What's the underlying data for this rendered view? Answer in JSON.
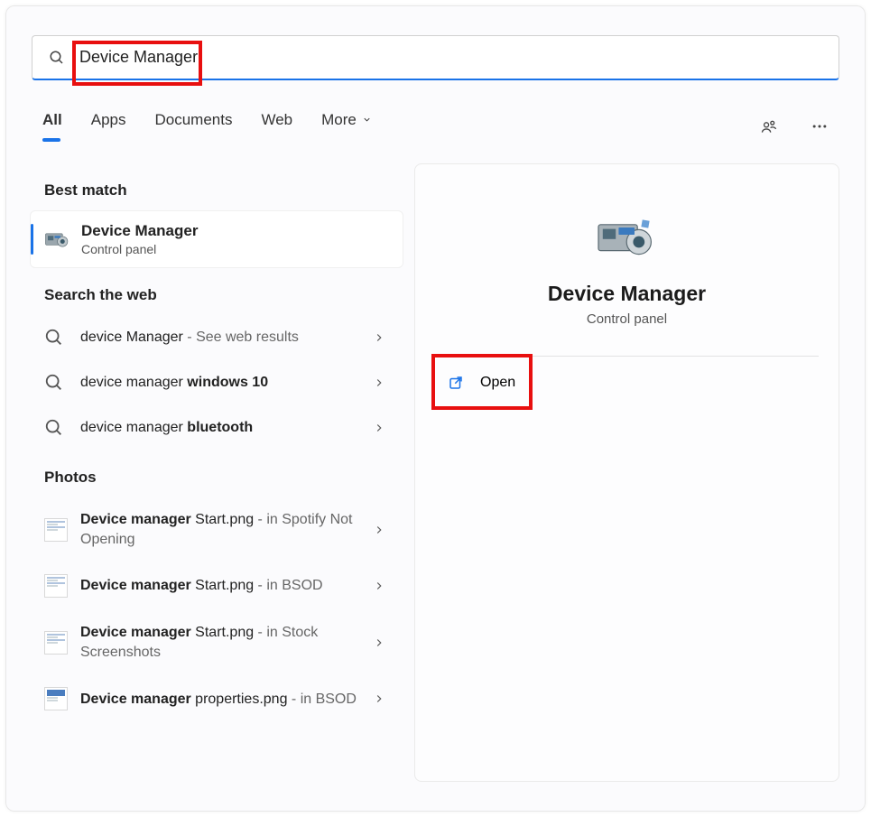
{
  "search": {
    "value": "Device Manager"
  },
  "tabs": {
    "all": "All",
    "apps": "Apps",
    "documents": "Documents",
    "web": "Web",
    "more": "More"
  },
  "best_match_header": "Best match",
  "best_match": {
    "title": "Device Manager",
    "subtitle": "Control panel"
  },
  "web_header": "Search the web",
  "web_results": [
    {
      "prefix": "device Manager",
      "suffix": " - See web results"
    },
    {
      "prefix": "device manager ",
      "bold": "windows 10"
    },
    {
      "prefix": "device manager ",
      "bold": "bluetooth"
    }
  ],
  "photos_header": "Photos",
  "photos": [
    {
      "bold": "Device manager",
      "rest": " Start.png",
      "loc": " - in Spotify Not Opening"
    },
    {
      "bold": "Device manager",
      "rest": " Start.png",
      "loc": " - in BSOD"
    },
    {
      "bold": "Device manager",
      "rest": " Start.png",
      "loc": " - in Stock Screenshots"
    },
    {
      "bold": "Device manager",
      "rest": " properties.png",
      "loc": " - in BSOD"
    }
  ],
  "preview": {
    "title": "Device Manager",
    "subtitle": "Control panel",
    "open": "Open"
  }
}
